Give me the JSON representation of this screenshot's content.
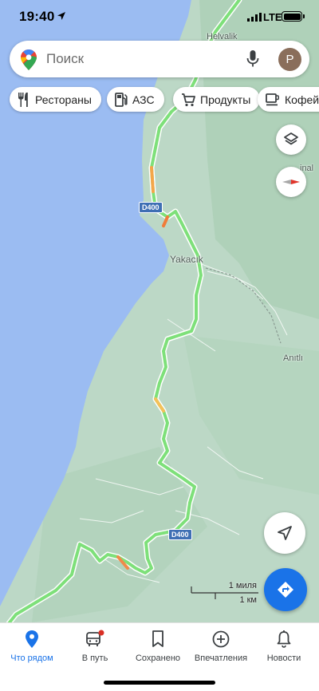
{
  "status_bar": {
    "time": "19:40",
    "network": "LTE"
  },
  "search": {
    "placeholder": "Поиск",
    "avatar_letter": "P"
  },
  "chips": [
    {
      "label": "Рестораны",
      "icon": "fork-knife-icon"
    },
    {
      "label": "АЗС",
      "icon": "gas-station-icon"
    },
    {
      "label": "Продукты",
      "icon": "cart-icon"
    },
    {
      "label": "Кофейн",
      "icon": "coffee-icon"
    }
  ],
  "map": {
    "places": [
      "Helvalik",
      "Yakacık",
      "Anıtlı",
      "inal"
    ],
    "road_shields": [
      "D400",
      "D400"
    ],
    "scale": {
      "imperial": "1 миля",
      "metric": "1 км"
    },
    "colors": {
      "sea": "#9bbcf2",
      "land": "#bcd8c6",
      "road": "#7ee07a",
      "traffic_slow": "#f4a64a"
    }
  },
  "bottom_nav": [
    {
      "label": "Что рядом",
      "icon": "location-pin-icon",
      "active": true
    },
    {
      "label": "В путь",
      "icon": "commute-icon",
      "active": false
    },
    {
      "label": "Сохранено",
      "icon": "bookmark-icon",
      "active": false
    },
    {
      "label": "Впечатления",
      "icon": "add-circle-icon",
      "active": false
    },
    {
      "label": "Новости",
      "icon": "bell-icon",
      "active": false
    }
  ]
}
